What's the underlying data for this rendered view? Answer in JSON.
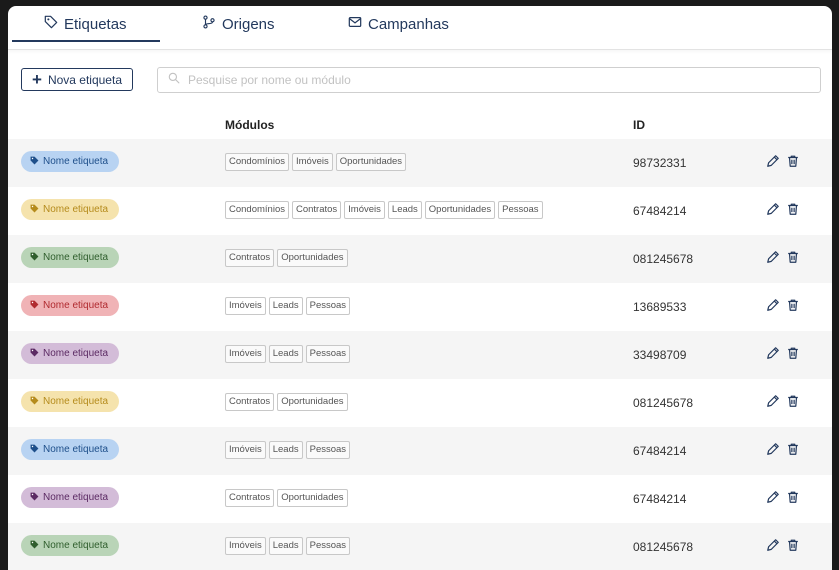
{
  "tabs": [
    {
      "label": "Etiquetas",
      "icon": "tag-icon",
      "active": true
    },
    {
      "label": "Origens",
      "icon": "git-branch-icon",
      "active": false
    },
    {
      "label": "Campanhas",
      "icon": "envelope-icon",
      "active": false
    }
  ],
  "toolbar": {
    "new_label": "Nova etiqueta",
    "search_placeholder": "Pesquise por nome ou módulo"
  },
  "table": {
    "headers": {
      "modules": "Módulos",
      "id": "ID"
    },
    "rows": [
      {
        "tag": "Nome etiqueta",
        "color": "blue",
        "modules": [
          "Condomínios",
          "Imóveis",
          "Oportunidades"
        ],
        "id": "98732331"
      },
      {
        "tag": "Nome etiqueta",
        "color": "yellow",
        "modules": [
          "Condomínios",
          "Contratos",
          "Imóveis",
          "Leads",
          "Oportunidades",
          "Pessoas"
        ],
        "id": "67484214"
      },
      {
        "tag": "Nome etiqueta",
        "color": "green",
        "modules": [
          "Contratos",
          "Oportunidades"
        ],
        "id": "081245678"
      },
      {
        "tag": "Nome etiqueta",
        "color": "red",
        "modules": [
          "Imóveis",
          "Leads",
          "Pessoas"
        ],
        "id": "13689533"
      },
      {
        "tag": "Nome etiqueta",
        "color": "purple",
        "modules": [
          "Imóveis",
          "Leads",
          "Pessoas"
        ],
        "id": "33498709"
      },
      {
        "tag": "Nome etiqueta",
        "color": "yellow",
        "modules": [
          "Contratos",
          "Oportunidades"
        ],
        "id": "081245678"
      },
      {
        "tag": "Nome etiqueta",
        "color": "blue",
        "modules": [
          "Imóveis",
          "Leads",
          "Pessoas"
        ],
        "id": "67484214"
      },
      {
        "tag": "Nome etiqueta",
        "color": "purple",
        "modules": [
          "Contratos",
          "Oportunidades"
        ],
        "id": "67484214"
      },
      {
        "tag": "Nome etiqueta",
        "color": "green",
        "modules": [
          "Imóveis",
          "Leads",
          "Pessoas"
        ],
        "id": "081245678"
      }
    ]
  },
  "tag_colors": {
    "blue": {
      "bg": "#b8d3f2",
      "fg": "#1e4f8a"
    },
    "yellow": {
      "bg": "#f5e3ad",
      "fg": "#b58b1c"
    },
    "green": {
      "bg": "#b9d4b7",
      "fg": "#2f5e2d"
    },
    "red": {
      "bg": "#f0b3b6",
      "fg": "#b02a2f"
    },
    "purple": {
      "bg": "#d3bcd8",
      "fg": "#5b2a63"
    }
  },
  "colors": {
    "accent": "#23395d"
  }
}
